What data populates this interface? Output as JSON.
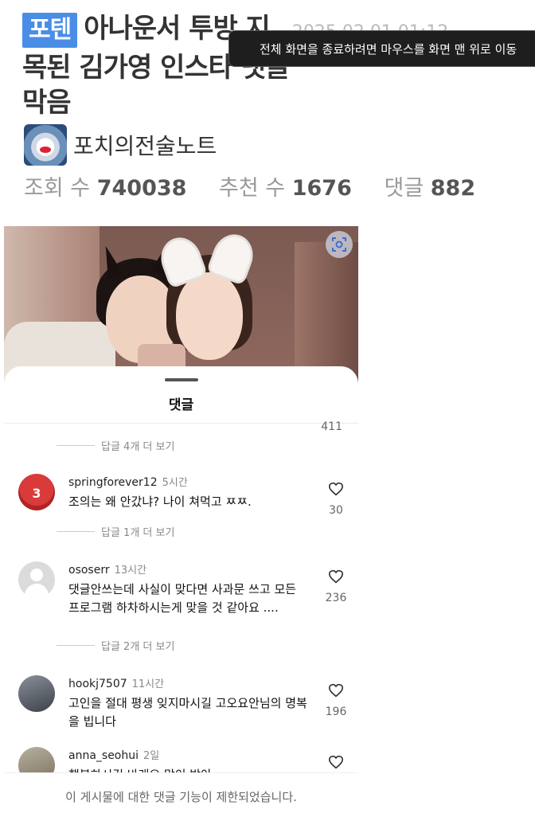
{
  "header": {
    "category": "포텐",
    "title_line1": "아나운서 투방 지",
    "date": "2025.02.01 01:12",
    "title_line2": "목된 김가영 인스타 댓글",
    "title_line3": "막음"
  },
  "fullscreen_toast": "전체 화면을 종료하려면 마우스를 화면 맨 위로 이동",
  "author": {
    "name": "포치의전술노트",
    "avatar_icon": "avatar-icon"
  },
  "stats": {
    "views_label": "조회 수",
    "views": "740038",
    "recommend_label": "추천 수",
    "recommend": "1676",
    "comments_label": "댓글",
    "comments": "882"
  },
  "photo": {
    "lens_icon": "lens-search-icon"
  },
  "sheet": {
    "title": "댓글",
    "top_like_count": "411",
    "top_reply_link": "답글 4개 더 보기",
    "comments": [
      {
        "user": "springforever12",
        "time": "5시간",
        "text": "조의는 왜 안갔냐? 나이 쳐먹고 ㅉㅉ.",
        "likes": "30",
        "reply_link": "답글 1개 더 보기"
      },
      {
        "user": "ososerr",
        "time": "13시간",
        "text": "댓글안쓰는데 사실이 맞다면 사과문 쓰고 모든 프로그램 하차하시는게 맞을 것 같아요 ....",
        "likes": "236",
        "reply_link": "답글 2개 더 보기"
      },
      {
        "user": "hookj7507",
        "time": "11시간",
        "text": "고인을 절대 평생 잊지마시길 고오요안님의 명복을 빕니다",
        "likes": "196"
      },
      {
        "user": "anna_seohui",
        "time": "2일",
        "text": "행복하시길 바래요 많이 받아"
      }
    ],
    "restricted_notice": "이 게시물에 대한 댓글 기능이 제한되었습니다."
  },
  "colors": {
    "badge": "#4a8de6",
    "toast_bg": "#1e1e1e"
  }
}
